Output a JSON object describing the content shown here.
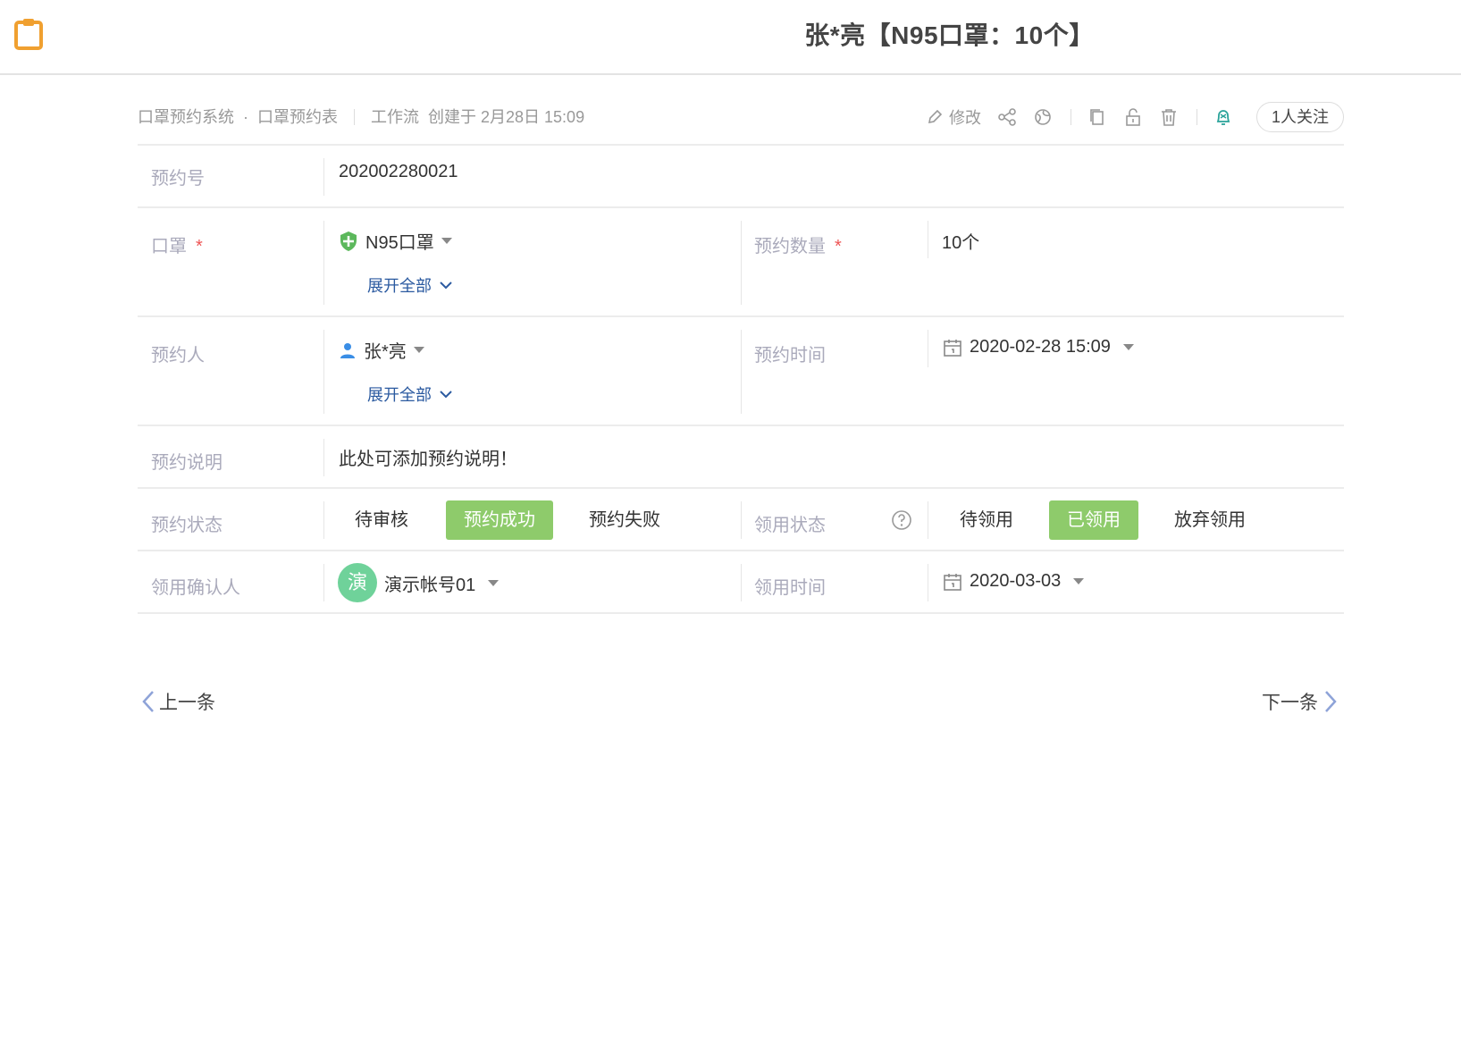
{
  "header": {
    "title": "张*亮【N95口罩：10个】",
    "app_icon": "clipboard-icon"
  },
  "meta": {
    "breadcrumb_app": "口罩预约系统",
    "breadcrumb_dot": "·",
    "breadcrumb_table": "口罩预约表",
    "source": "工作流",
    "created": "创建于 2月28日 15:09",
    "edit_label": "修改",
    "follow_label": "1人关注"
  },
  "fields": {
    "reservation_no": {
      "label": "预约号",
      "value": "202002280021"
    },
    "mask": {
      "label": "口罩",
      "required": "*",
      "value": "N95口罩",
      "expand": "展开全部"
    },
    "quantity": {
      "label": "预约数量",
      "required": "*",
      "value": "10个"
    },
    "person": {
      "label": "预约人",
      "value": "张*亮",
      "expand": "展开全部"
    },
    "time": {
      "label": "预约时间",
      "value": "2020-02-28 15:09"
    },
    "note": {
      "label": "预约说明",
      "value": "此处可添加预约说明！"
    },
    "status": {
      "label": "预约状态",
      "options": [
        "待审核",
        "预约成功",
        "预约失败"
      ],
      "selected": "预约成功"
    },
    "pickup_status": {
      "label": "领用状态",
      "options": [
        "待领用",
        "已领用",
        "放弃领用"
      ],
      "selected": "已领用"
    },
    "confirmer": {
      "label": "领用确认人",
      "avatar_char": "演",
      "value": "演示帐号01"
    },
    "pickup_time": {
      "label": "领用时间",
      "value": "2020-03-03"
    }
  },
  "nav": {
    "prev": "上一条",
    "next": "下一条"
  },
  "colors": {
    "accent_green": "#8ecb6b",
    "link_blue": "#2b5aa0",
    "icon_orange": "#f0a030",
    "avatar_green": "#6fd29a"
  }
}
